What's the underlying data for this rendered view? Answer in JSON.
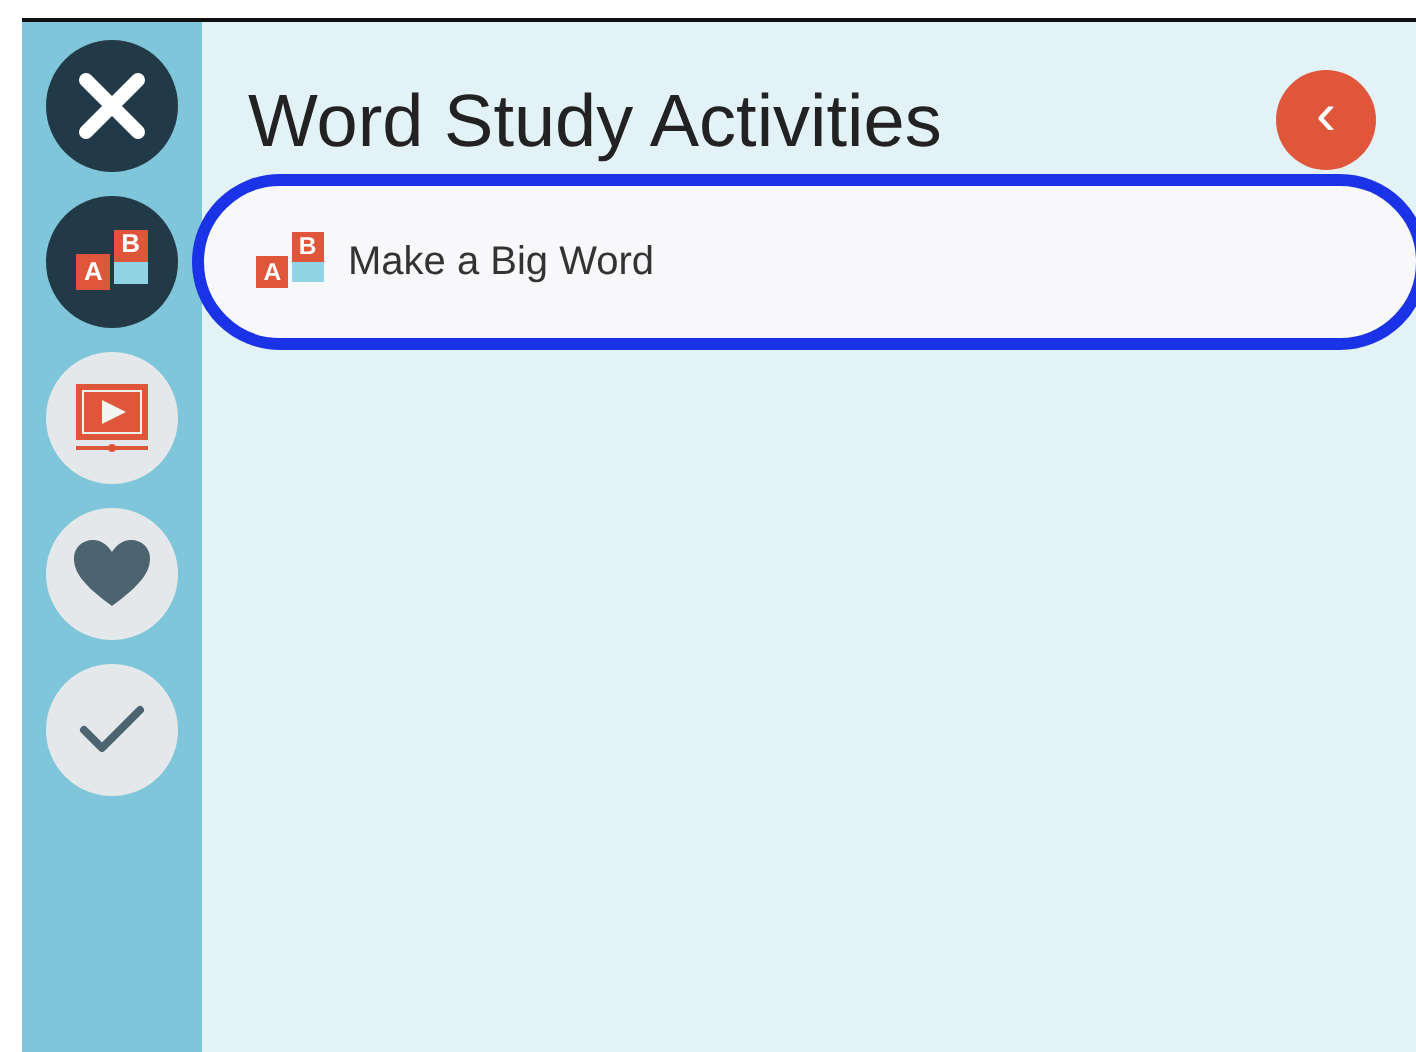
{
  "sidebar": {
    "close_button": {
      "kind": "close"
    },
    "items": [
      {
        "kind": "blocks",
        "letters": [
          "A",
          "B"
        ],
        "selected": true
      },
      {
        "kind": "video",
        "selected": false
      },
      {
        "kind": "heart",
        "selected": false
      },
      {
        "kind": "check",
        "selected": false
      }
    ]
  },
  "title": "Word Study Activities",
  "back_button": {
    "label": "‹"
  },
  "activities": [
    {
      "label": "Make a Big Word",
      "letters": [
        "A",
        "B"
      ],
      "focused": true
    }
  ]
}
